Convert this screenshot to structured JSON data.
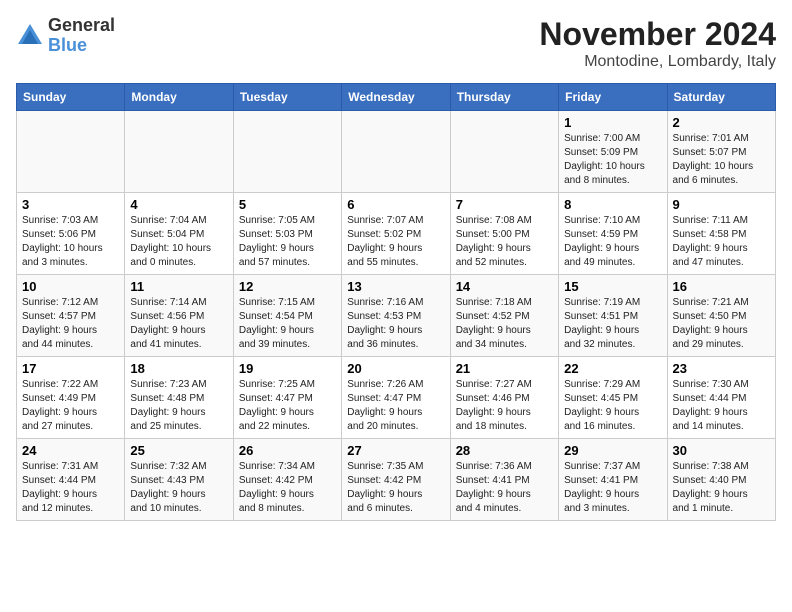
{
  "header": {
    "logo_general": "General",
    "logo_blue": "Blue",
    "month_title": "November 2024",
    "location": "Montodine, Lombardy, Italy"
  },
  "columns": [
    "Sunday",
    "Monday",
    "Tuesday",
    "Wednesday",
    "Thursday",
    "Friday",
    "Saturday"
  ],
  "weeks": [
    [
      {
        "day": "",
        "info": ""
      },
      {
        "day": "",
        "info": ""
      },
      {
        "day": "",
        "info": ""
      },
      {
        "day": "",
        "info": ""
      },
      {
        "day": "",
        "info": ""
      },
      {
        "day": "1",
        "info": "Sunrise: 7:00 AM\nSunset: 5:09 PM\nDaylight: 10 hours\nand 8 minutes."
      },
      {
        "day": "2",
        "info": "Sunrise: 7:01 AM\nSunset: 5:07 PM\nDaylight: 10 hours\nand 6 minutes."
      }
    ],
    [
      {
        "day": "3",
        "info": "Sunrise: 7:03 AM\nSunset: 5:06 PM\nDaylight: 10 hours\nand 3 minutes."
      },
      {
        "day": "4",
        "info": "Sunrise: 7:04 AM\nSunset: 5:04 PM\nDaylight: 10 hours\nand 0 minutes."
      },
      {
        "day": "5",
        "info": "Sunrise: 7:05 AM\nSunset: 5:03 PM\nDaylight: 9 hours\nand 57 minutes."
      },
      {
        "day": "6",
        "info": "Sunrise: 7:07 AM\nSunset: 5:02 PM\nDaylight: 9 hours\nand 55 minutes."
      },
      {
        "day": "7",
        "info": "Sunrise: 7:08 AM\nSunset: 5:00 PM\nDaylight: 9 hours\nand 52 minutes."
      },
      {
        "day": "8",
        "info": "Sunrise: 7:10 AM\nSunset: 4:59 PM\nDaylight: 9 hours\nand 49 minutes."
      },
      {
        "day": "9",
        "info": "Sunrise: 7:11 AM\nSunset: 4:58 PM\nDaylight: 9 hours\nand 47 minutes."
      }
    ],
    [
      {
        "day": "10",
        "info": "Sunrise: 7:12 AM\nSunset: 4:57 PM\nDaylight: 9 hours\nand 44 minutes."
      },
      {
        "day": "11",
        "info": "Sunrise: 7:14 AM\nSunset: 4:56 PM\nDaylight: 9 hours\nand 41 minutes."
      },
      {
        "day": "12",
        "info": "Sunrise: 7:15 AM\nSunset: 4:54 PM\nDaylight: 9 hours\nand 39 minutes."
      },
      {
        "day": "13",
        "info": "Sunrise: 7:16 AM\nSunset: 4:53 PM\nDaylight: 9 hours\nand 36 minutes."
      },
      {
        "day": "14",
        "info": "Sunrise: 7:18 AM\nSunset: 4:52 PM\nDaylight: 9 hours\nand 34 minutes."
      },
      {
        "day": "15",
        "info": "Sunrise: 7:19 AM\nSunset: 4:51 PM\nDaylight: 9 hours\nand 32 minutes."
      },
      {
        "day": "16",
        "info": "Sunrise: 7:21 AM\nSunset: 4:50 PM\nDaylight: 9 hours\nand 29 minutes."
      }
    ],
    [
      {
        "day": "17",
        "info": "Sunrise: 7:22 AM\nSunset: 4:49 PM\nDaylight: 9 hours\nand 27 minutes."
      },
      {
        "day": "18",
        "info": "Sunrise: 7:23 AM\nSunset: 4:48 PM\nDaylight: 9 hours\nand 25 minutes."
      },
      {
        "day": "19",
        "info": "Sunrise: 7:25 AM\nSunset: 4:47 PM\nDaylight: 9 hours\nand 22 minutes."
      },
      {
        "day": "20",
        "info": "Sunrise: 7:26 AM\nSunset: 4:47 PM\nDaylight: 9 hours\nand 20 minutes."
      },
      {
        "day": "21",
        "info": "Sunrise: 7:27 AM\nSunset: 4:46 PM\nDaylight: 9 hours\nand 18 minutes."
      },
      {
        "day": "22",
        "info": "Sunrise: 7:29 AM\nSunset: 4:45 PM\nDaylight: 9 hours\nand 16 minutes."
      },
      {
        "day": "23",
        "info": "Sunrise: 7:30 AM\nSunset: 4:44 PM\nDaylight: 9 hours\nand 14 minutes."
      }
    ],
    [
      {
        "day": "24",
        "info": "Sunrise: 7:31 AM\nSunset: 4:44 PM\nDaylight: 9 hours\nand 12 minutes."
      },
      {
        "day": "25",
        "info": "Sunrise: 7:32 AM\nSunset: 4:43 PM\nDaylight: 9 hours\nand 10 minutes."
      },
      {
        "day": "26",
        "info": "Sunrise: 7:34 AM\nSunset: 4:42 PM\nDaylight: 9 hours\nand 8 minutes."
      },
      {
        "day": "27",
        "info": "Sunrise: 7:35 AM\nSunset: 4:42 PM\nDaylight: 9 hours\nand 6 minutes."
      },
      {
        "day": "28",
        "info": "Sunrise: 7:36 AM\nSunset: 4:41 PM\nDaylight: 9 hours\nand 4 minutes."
      },
      {
        "day": "29",
        "info": "Sunrise: 7:37 AM\nSunset: 4:41 PM\nDaylight: 9 hours\nand 3 minutes."
      },
      {
        "day": "30",
        "info": "Sunrise: 7:38 AM\nSunset: 4:40 PM\nDaylight: 9 hours\nand 1 minute."
      }
    ]
  ]
}
